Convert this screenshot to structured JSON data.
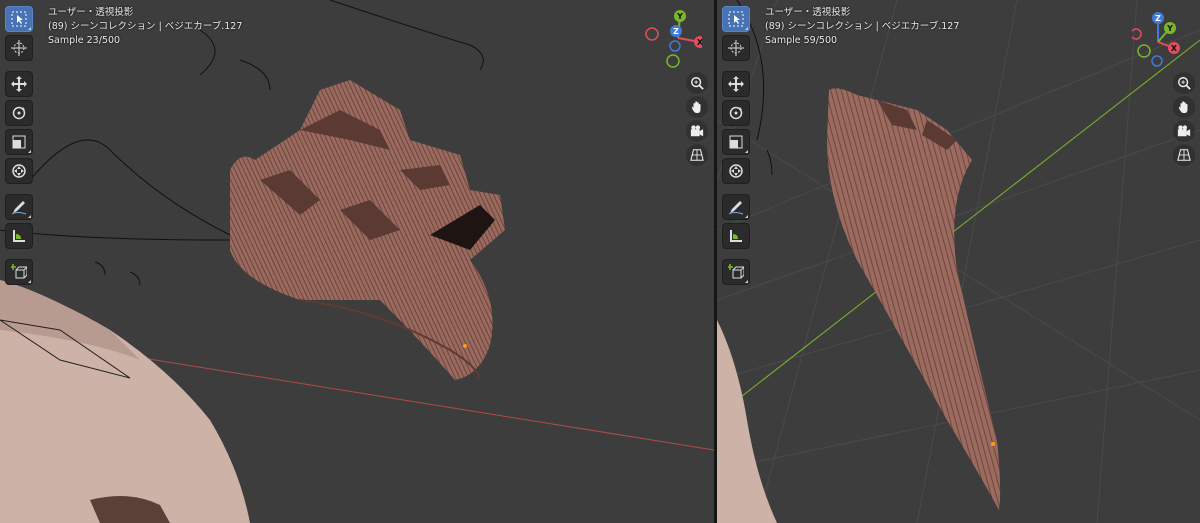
{
  "left_viewport": {
    "view_name": "ユーザー・透視投影",
    "collection": "(89) シーンコレクション | ベジエカーブ.127",
    "sample": "Sample 23/500"
  },
  "right_viewport": {
    "view_name": "ユーザー・透視投影",
    "collection": "(89) シーンコレクション | ベジエカーブ.127",
    "sample": "Sample 59/500"
  },
  "gizmo_axes": {
    "x": "X",
    "y": "Y",
    "z": "Z"
  },
  "colors": {
    "viewport_bg": "#3d3d3d",
    "active_tool": "#4772b3",
    "axis_x": "#e24e5c",
    "axis_y": "#7ab72b",
    "axis_z": "#3f7bd8",
    "hair": "#9b6a60",
    "skin": "#cdb2a8"
  },
  "toolbar_icons": [
    "select-box-icon",
    "cursor-icon",
    "move-icon",
    "rotate-icon",
    "scale-icon",
    "transform-icon",
    "annotate-icon",
    "measure-icon",
    "add-cube-icon"
  ],
  "nav_icons": [
    "zoom-icon",
    "pan-hand-icon",
    "camera-icon",
    "grid-perspective-icon"
  ]
}
